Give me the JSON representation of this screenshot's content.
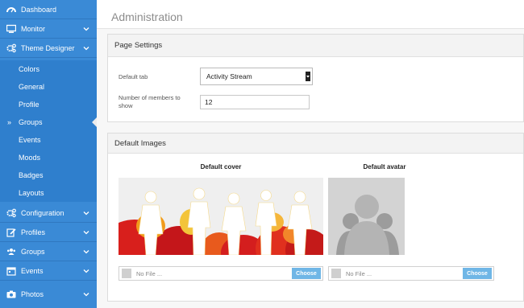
{
  "sidebar": {
    "items": [
      {
        "label": "Dashboard",
        "icon": "dashboard-icon"
      },
      {
        "label": "Monitor",
        "icon": "monitor-icon"
      },
      {
        "label": "Theme Designer",
        "icon": "gears-icon"
      },
      {
        "label": "Colors"
      },
      {
        "label": "General"
      },
      {
        "label": "Profile"
      },
      {
        "label": "Groups",
        "marker": "»"
      },
      {
        "label": "Events"
      },
      {
        "label": "Moods"
      },
      {
        "label": "Badges"
      },
      {
        "label": "Layouts"
      },
      {
        "label": "Configuration",
        "icon": "gears-icon"
      },
      {
        "label": "Profiles",
        "icon": "edit-icon"
      },
      {
        "label": "Groups",
        "icon": "users-icon"
      },
      {
        "label": "Events",
        "icon": "calendar-icon"
      },
      {
        "label": "Photos",
        "icon": "camera-icon"
      }
    ]
  },
  "main": {
    "title": "Administration",
    "page_settings": {
      "heading": "Page Settings",
      "default_tab_label": "Default tab",
      "default_tab_value": "Activity Stream",
      "members_label": "Number of members to show",
      "members_value": "12"
    },
    "default_images": {
      "heading": "Default Images",
      "cover_title": "Default cover",
      "avatar_title": "Default avatar",
      "cover_file_text": "No File ...",
      "avatar_file_text": "No File ...",
      "choose_label": "Choose"
    }
  },
  "colors": {
    "sidebar": "#3a8ad6",
    "submenu": "#2f7fcd",
    "choose_button": "#6fb6e6"
  }
}
